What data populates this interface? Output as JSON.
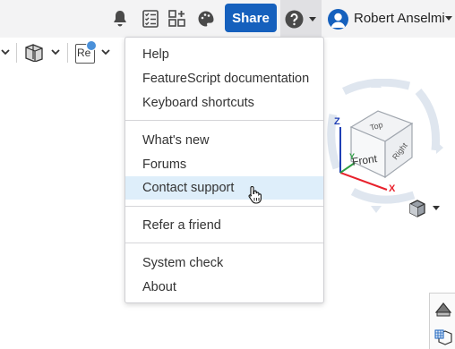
{
  "topbar": {
    "icons": [
      "bell-icon",
      "checklist-icon",
      "app-store-icon",
      "palette-icon"
    ],
    "share_label": "Share",
    "help_icon": "question-circle-icon",
    "user_name": "Robert Anselmi"
  },
  "toolbar": {
    "icons": [
      "view-icon",
      "section-view-icon",
      "render-icon"
    ],
    "render_badge": "Re"
  },
  "help_menu": {
    "groups": [
      [
        "Help",
        "FeatureScript documentation",
        "Keyboard shortcuts"
      ],
      [
        "What's new",
        "Forums",
        "Contact support"
      ],
      [
        "Refer a friend"
      ],
      [
        "System check",
        "About"
      ]
    ],
    "highlighted": "Contact support"
  },
  "view_cube": {
    "faces": {
      "top": "Top",
      "front": "Front",
      "right": "Right"
    },
    "axes": {
      "x": "X",
      "y": "Y",
      "z": "Z"
    },
    "colors": {
      "x": "#e8212c",
      "y": "#2f9e44",
      "z": "#1f3fb5"
    }
  },
  "colors": {
    "accent": "#1560bd",
    "highlight": "#deeefa",
    "topbar_bg": "#f3f3f4"
  }
}
